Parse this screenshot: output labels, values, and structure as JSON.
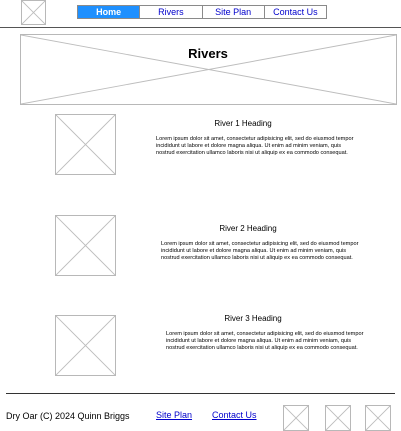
{
  "nav": {
    "items": [
      {
        "label": "Home",
        "active": true
      },
      {
        "label": "Rivers",
        "active": false
      },
      {
        "label": "Site Plan",
        "active": false
      },
      {
        "label": "Contact Us",
        "active": false
      }
    ]
  },
  "hero": {
    "title": "Rivers"
  },
  "rivers": [
    {
      "heading": "River 1 Heading",
      "text": "Lorem ipsum dolor sit amet, consectetur adipisicing elit, sed do eiusmod tempor incididunt ut labore et dolore magna aliqua. Ut enim ad minim veniam, quis nostrud exercitation ullamco laboris nisi ut aliquip ex ea commodo consequat."
    },
    {
      "heading": "River 2 Heading",
      "text": "Lorem ipsum dolor sit amet, consectetur adipisicing elit, sed do eiusmod tempor incididunt ut labore et dolore magna aliqua. Ut enim ad minim veniam, quis nostrud exercitation ullamco laboris nisi ut aliquip ex ea commodo consequat."
    },
    {
      "heading": "River 3 Heading",
      "text": "Lorem ipsum dolor sit amet, consectetur adipisicing elit, sed do eiusmod tempor incididunt ut labore et dolore magna aliqua. Ut enim ad minim veniam, quis nostrud exercitation ullamco laboris nisi ut aliquip ex ea commodo consequat."
    }
  ],
  "footer": {
    "copyright": "Dry Oar (C) 2024 Quinn Briggs",
    "site_plan_label": "Site Plan",
    "contact_label": "Contact Us"
  },
  "colors": {
    "nav_active_bg": "#1e90ff",
    "link": "#0000cc"
  }
}
